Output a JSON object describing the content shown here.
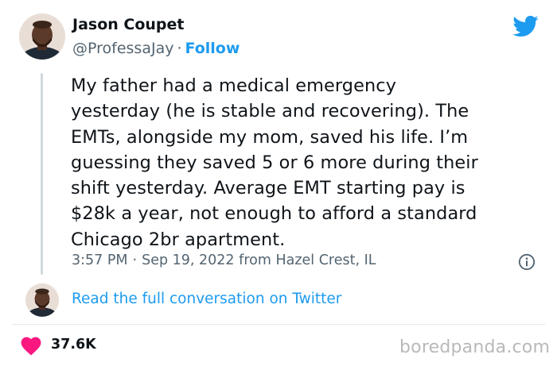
{
  "author": {
    "display_name": "Jason Coupet",
    "handle": "@ProfessaJay",
    "separator": "·",
    "follow_label": "Follow"
  },
  "tweet": {
    "lines": [
      "My father had a medical emergency",
      "yesterday (he is stable and recovering). The",
      "EMTs, alongside my mom, saved his life. I’m",
      "guessing they saved 5 or 6 more during their",
      "shift yesterday. Average EMT starting pay is",
      "$28k a year, not enough to afford a standard",
      "Chicago 2br apartment."
    ],
    "time": "3:57 PM",
    "meta_separator": "·",
    "date": "Sep 19, 2022",
    "location": "from Hazel Crest, IL"
  },
  "conversation_link": "Read the full conversation on Twitter",
  "likes": "37.6K",
  "watermark": "boredpanda.com",
  "colors": {
    "brand_blue": "#1d9bf0",
    "heart_red": "#f91880",
    "muted_text": "#536471"
  },
  "icons": {
    "brand": "twitter-bird-icon",
    "info": "info-icon",
    "like": "heart-icon"
  }
}
